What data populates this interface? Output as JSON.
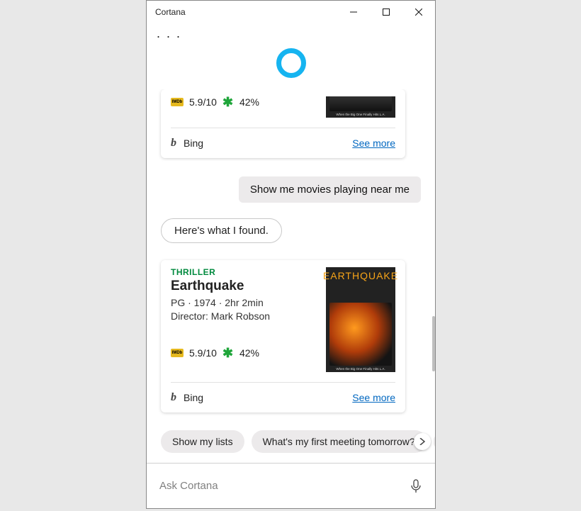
{
  "window": {
    "title": "Cortana",
    "menu_dots": ". . ."
  },
  "cards": [
    {
      "imdb": "5.9/10",
      "rt": "42%",
      "poster_tag": "When the Big One Finally Hits L.A.",
      "bing": "Bing",
      "see_more": "See more"
    },
    {
      "genre": "THRILLER",
      "title": "Earthquake",
      "meta": "PG · 1974 · 2hr 2min",
      "director": "Director: Mark Robson",
      "imdb": "5.9/10",
      "rt": "42%",
      "poster_title": "EARTHQUAKE",
      "poster_tag": "When the Big One Finally Hits L.A.",
      "bing": "Bing",
      "see_more": "See more"
    }
  ],
  "user_msg": "Show me movies playing near me",
  "cortana_msg": "Here's what I found.",
  "suggestions": {
    "a": "Show my lists",
    "b": "What's my first meeting tomorrow?"
  },
  "input": {
    "placeholder": "Ask Cortana"
  }
}
